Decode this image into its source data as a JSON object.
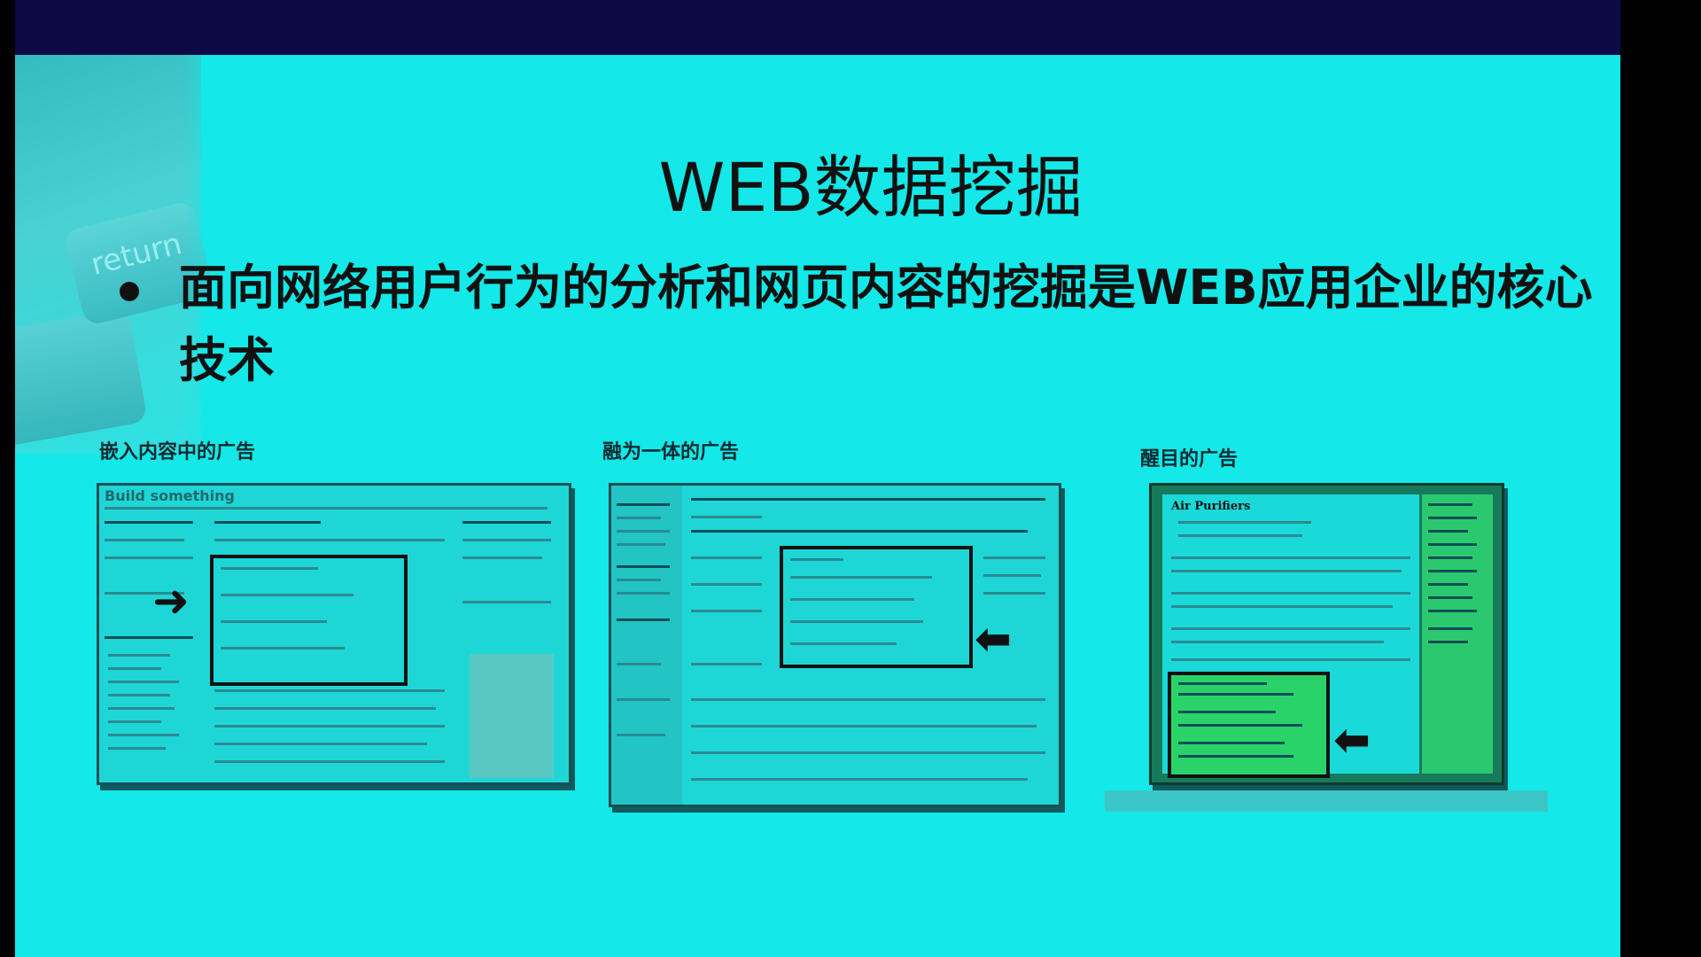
{
  "slide": {
    "title": "WEB数据挖掘",
    "bullet": "面向网络用户行为的分析和网页内容的挖掘是WEB应用企业的核心技术"
  },
  "decoration": {
    "key_label": "return"
  },
  "examples": [
    {
      "caption": "嵌入内容中的广告",
      "screenshot_heading": "Build something"
    },
    {
      "caption": "融为一体的广告"
    },
    {
      "caption": "醒目的广告",
      "screenshot_heading": "Air Purifiers"
    }
  ],
  "colors": {
    "slide_bg": "#14e8e8",
    "top_bar": "#0b0a47",
    "ad_highlight": "#2ad36a"
  }
}
